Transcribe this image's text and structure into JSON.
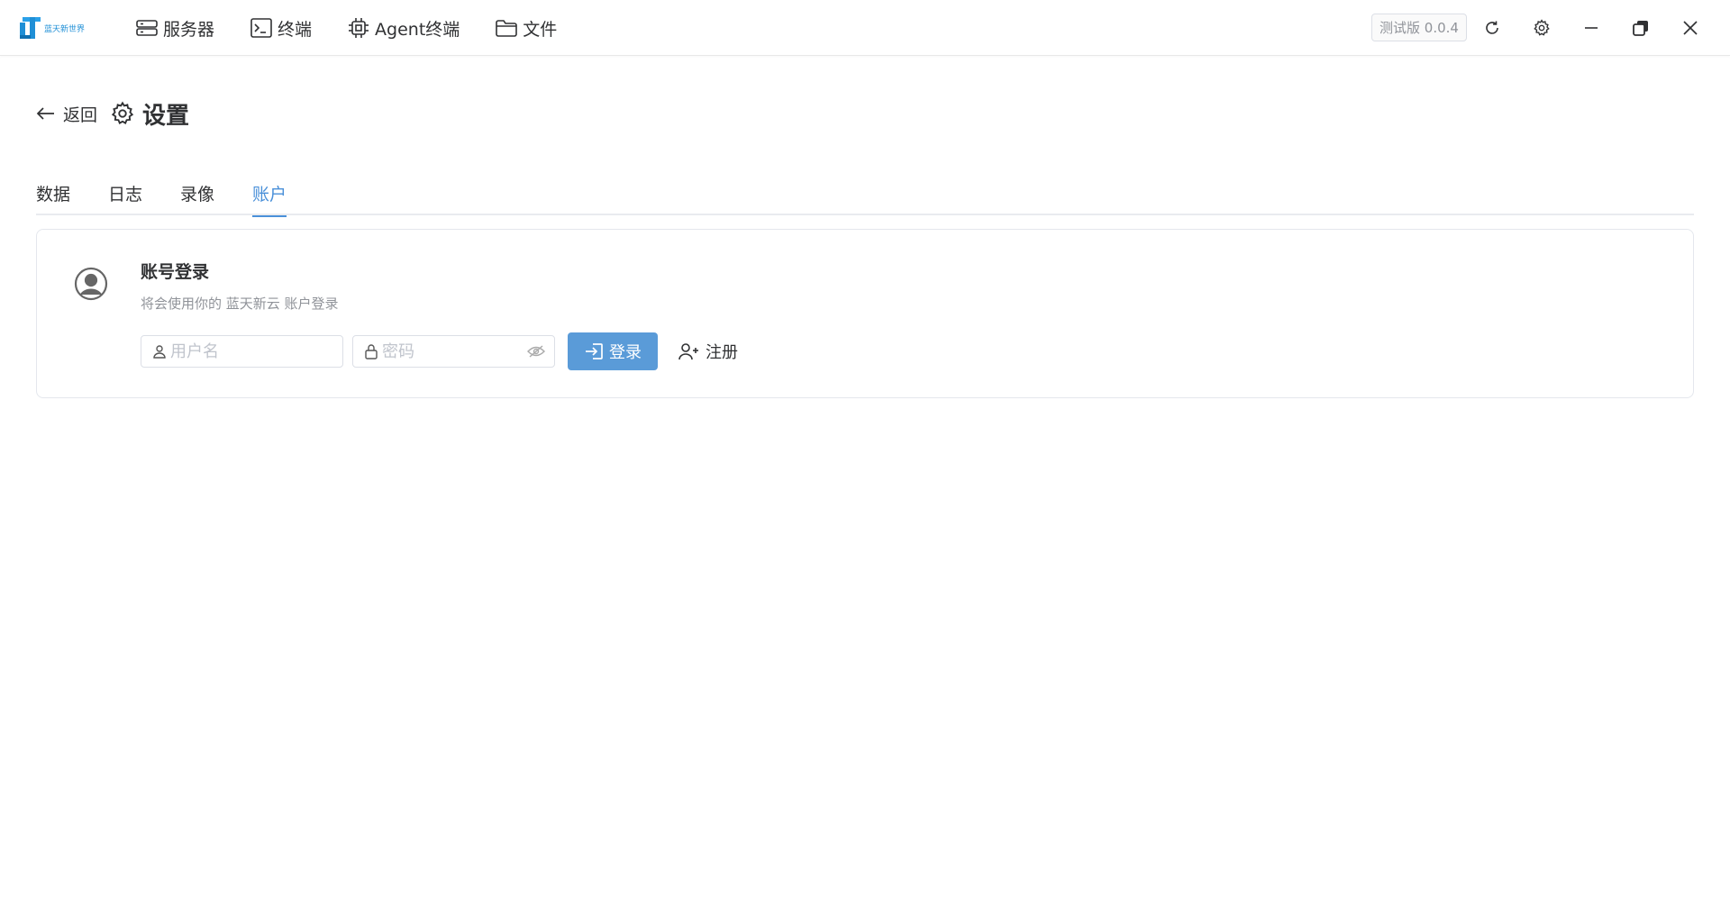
{
  "app": {
    "logo_text": "蓝天新世界",
    "version": "测试版 0.0.4"
  },
  "nav": [
    {
      "label": "服务器",
      "icon": "server-icon"
    },
    {
      "label": "终端",
      "icon": "terminal-icon"
    },
    {
      "label": "Agent终端",
      "icon": "chip-icon"
    },
    {
      "label": "文件",
      "icon": "folder-icon"
    }
  ],
  "window_controls": [
    "refresh-icon",
    "gear-icon",
    "minimize-icon",
    "restore-icon",
    "close-icon"
  ],
  "page": {
    "back_label": "返回",
    "title": "设置"
  },
  "tabs": [
    {
      "label": "数据",
      "active": false
    },
    {
      "label": "日志",
      "active": false
    },
    {
      "label": "录像",
      "active": false
    },
    {
      "label": "账户",
      "active": true
    }
  ],
  "account": {
    "title": "账号登录",
    "description": "将会使用你的 蓝天新云 账户登录",
    "username_placeholder": "用户名",
    "username_value": "",
    "password_placeholder": "密码",
    "password_value": "",
    "login_label": "登录",
    "register_label": "注册"
  },
  "colors": {
    "accent": "#4a90d9",
    "button": "#5a9bd8",
    "muted": "#909399",
    "logo": "#1f8fd6"
  }
}
